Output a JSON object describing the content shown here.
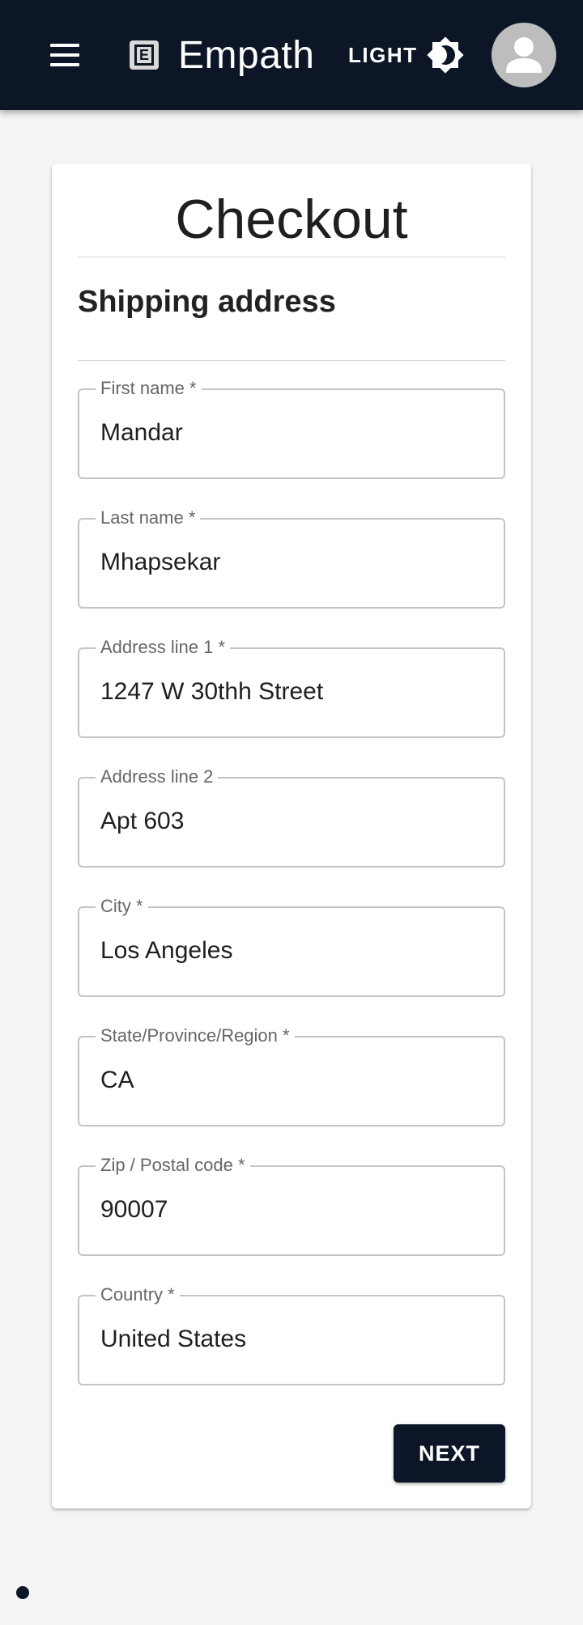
{
  "appbar": {
    "brand_logo_letter": "E",
    "brand_name": "Empath",
    "theme_label": "LIGHT",
    "icons": {
      "menu": "menu-icon",
      "brand": "brand-logo-icon",
      "theme": "brightness-icon",
      "avatar": "account-icon"
    },
    "background_color": "#0c1627"
  },
  "checkout": {
    "title": "Checkout",
    "section_title": "Shipping address",
    "fields": [
      {
        "label": "First name *",
        "value": "Mandar"
      },
      {
        "label": "Last name *",
        "value": "Mhapsekar"
      },
      {
        "label": "Address line 1 *",
        "value": "1247 W 30thh Street"
      },
      {
        "label": "Address line 2",
        "value": "Apt 603"
      },
      {
        "label": "City *",
        "value": "Los Angeles"
      },
      {
        "label": "State/Province/Region *",
        "value": "CA"
      },
      {
        "label": "Zip / Postal code *",
        "value": "90007"
      },
      {
        "label": "Country *",
        "value": "United States"
      }
    ],
    "next_label": "NEXT"
  },
  "colors": {
    "accent": "#0c1627",
    "page_background": "#f4f4f4",
    "card_background": "#ffffff"
  }
}
